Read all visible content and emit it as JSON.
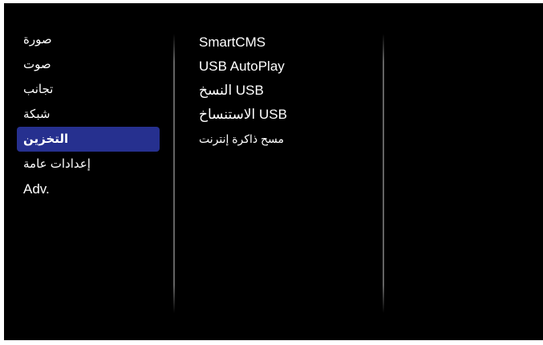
{
  "main_menu": {
    "items": [
      {
        "label": "صورة"
      },
      {
        "label": "صوت"
      },
      {
        "label": "تجانب"
      },
      {
        "label": "شبكة"
      },
      {
        "label": "التخزين"
      },
      {
        "label": "إعدادات عامة"
      },
      {
        "label": "Adv."
      }
    ],
    "selected_index": 4
  },
  "submenu": {
    "items": [
      {
        "label": "SmartCMS"
      },
      {
        "label": "USB AutoPlay"
      },
      {
        "label": "النسخ USB"
      },
      {
        "label": "الاستنساخ USB"
      },
      {
        "label": "مسح ذاكرة إنترنت"
      }
    ]
  },
  "colors": {
    "background": "#000000",
    "highlight": "#26308f",
    "text": "#ffffff"
  }
}
